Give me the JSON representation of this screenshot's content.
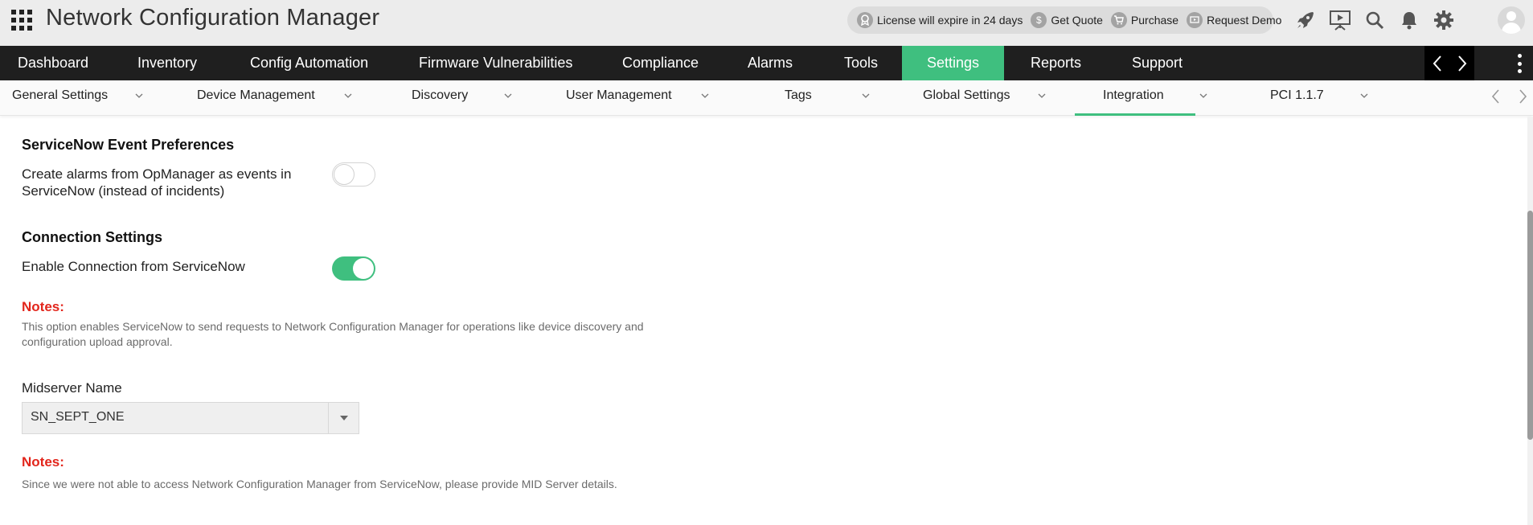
{
  "app": {
    "title": "Network Configuration Manager"
  },
  "promo": {
    "license": "License will expire in 24 days",
    "get_quote": "Get Quote",
    "purchase": "Purchase",
    "request_demo": "Request Demo"
  },
  "toolbar_icons": [
    "rocket-icon",
    "presentation-icon",
    "search-icon",
    "bell-icon",
    "gear-icon",
    "user-avatar-icon"
  ],
  "main_nav": {
    "items": [
      {
        "label": "Dashboard"
      },
      {
        "label": "Inventory"
      },
      {
        "label": "Config Automation"
      },
      {
        "label": "Firmware Vulnerabilities"
      },
      {
        "label": "Compliance"
      },
      {
        "label": "Alarms"
      },
      {
        "label": "Tools"
      },
      {
        "label": "Settings",
        "active": true
      },
      {
        "label": "Reports"
      },
      {
        "label": "Support"
      }
    ]
  },
  "sub_nav": {
    "items": [
      {
        "label": "General Settings"
      },
      {
        "label": "Device Management"
      },
      {
        "label": "Discovery"
      },
      {
        "label": "User Management"
      },
      {
        "label": "Tags"
      },
      {
        "label": "Global Settings"
      },
      {
        "label": "Integration",
        "active": true
      },
      {
        "label": "PCI 1.1.7"
      }
    ]
  },
  "servicenow": {
    "event_prefs_title": "ServiceNow Event Preferences",
    "create_alarms_label_line1": "Create alarms from OpManager as events in",
    "create_alarms_label_line2": "ServiceNow (instead of incidents)",
    "create_alarms_enabled": false,
    "connection_title": "Connection Settings",
    "enable_connection_label": "Enable Connection from ServiceNow",
    "enable_connection_enabled": true,
    "notes1_head": "Notes:",
    "notes1_line1": "This option enables ServiceNow to send requests to Network Configuration Manager for operations like device discovery and",
    "notes1_line2": "configuration upload approval.",
    "midserver_label": "Midserver Name",
    "midserver_value": "SN_SEPT_ONE",
    "notes2_head": "Notes:",
    "notes2_text": "Since we were not able to access Network Configuration Manager from ServiceNow, please provide MID Server details."
  },
  "colors": {
    "accent": "#3fbf7f",
    "nav_bg": "#1f1f1f",
    "notes": "#e2261c"
  }
}
